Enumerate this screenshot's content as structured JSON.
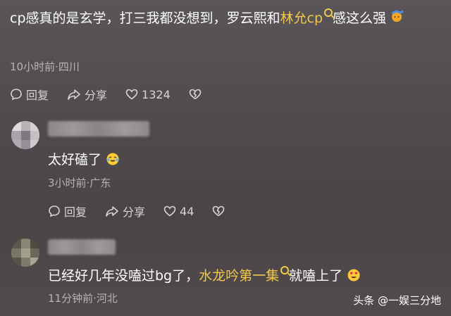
{
  "comment": {
    "text_before": "cp感真的是玄学，打三我都没想到，罗云熙和",
    "highlight": "林允cp",
    "text_after": "感这么强",
    "emoji_icon": "angry-face-icon",
    "meta": "10小时前·四川",
    "reply_label": "回复",
    "share_label": "分享",
    "likes": "1324"
  },
  "replies": [
    {
      "text": "太好磕了",
      "emoji_icon": "crying-laughing-face-icon",
      "meta": "3小时前·广东",
      "reply_label": "回复",
      "share_label": "分享",
      "likes": "44"
    },
    {
      "text_before": "已经好几年没嗑过bg了，",
      "highlight": "水龙吟第一集",
      "text_after": "就嗑上了",
      "emoji_icon": "heart-eyes-face-icon",
      "meta": "11分钟前·河北"
    }
  ],
  "watermark": "头条 @一娱三分地",
  "colors": {
    "highlight": "#f2c94c",
    "meta": "#b9b3b6"
  }
}
